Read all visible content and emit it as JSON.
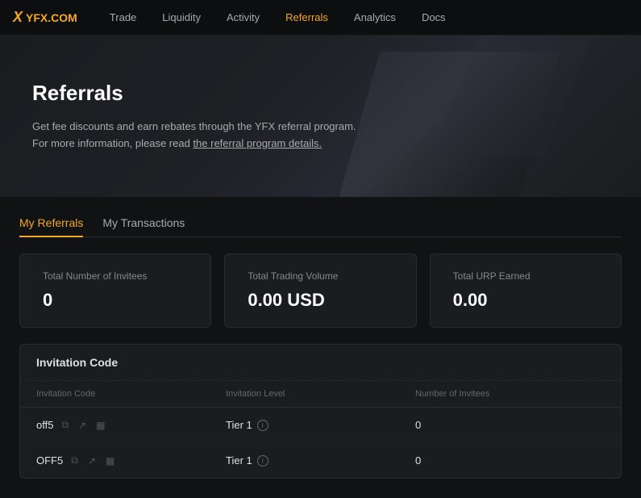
{
  "brand": {
    "logo_x": "X",
    "logo_name": "YFX.COM"
  },
  "nav": {
    "links": [
      {
        "label": "Trade",
        "active": false
      },
      {
        "label": "Liquidity",
        "active": false
      },
      {
        "label": "Activity",
        "active": false
      },
      {
        "label": "Referrals",
        "active": true
      },
      {
        "label": "Analytics",
        "active": false
      },
      {
        "label": "Docs",
        "active": false
      }
    ]
  },
  "hero": {
    "title": "Referrals",
    "desc_line1": "Get fee discounts and earn rebates through the YFX referral program.",
    "desc_line2": "For more information, please read",
    "link_text": "the referral program details."
  },
  "tabs": [
    {
      "label": "My Referrals",
      "active": true
    },
    {
      "label": "My Transactions",
      "active": false
    }
  ],
  "stats": [
    {
      "label": "Total Number of Invitees",
      "value": "0"
    },
    {
      "label": "Total Trading Volume",
      "value": "0.00 USD"
    },
    {
      "label": "Total URP Earned",
      "value": "0.00"
    }
  ],
  "invitation_section": {
    "title": "Invitation Code",
    "columns": [
      "Invitation Code",
      "Invitation Level",
      "Number of Invitees"
    ],
    "rows": [
      {
        "code": "off5",
        "tier": "Tier 1",
        "count": "0"
      },
      {
        "code": "OFF5",
        "tier": "Tier 1",
        "count": "0"
      }
    ]
  },
  "icons": {
    "copy": "⧉",
    "share": "↗",
    "qr": "▦",
    "info": "i"
  }
}
